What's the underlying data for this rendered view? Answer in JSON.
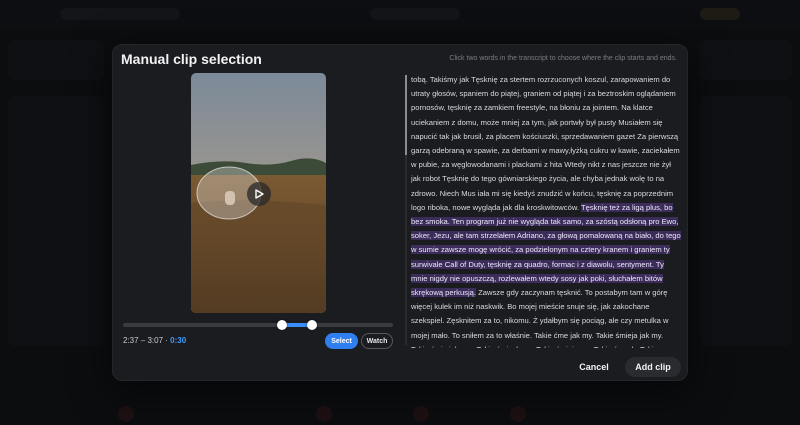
{
  "modal": {
    "title": "Manual clip selection",
    "hint": "Click two words in the transcript to choose where the clip starts and ends."
  },
  "player": {
    "range_label": "2:37 – 3:07",
    "separator": "·",
    "duration": "0:30",
    "select_label": "Select",
    "watch_label": "Watch",
    "play_icon": "play-icon",
    "selection_start_fraction": 0.59,
    "selection_end_fraction": 0.7
  },
  "transcript": {
    "before": "tobą. Takiśmy jak Tęsknię za stertem rozrzuconych koszul, zarapowaniem do utraty głosów, spaniem do piątej, graniem od piątej i za beztroskim oglądaniem pornosów, tęsknię za zamkiem freestyle, na błoniu za jointem. Na klatce uciekaniem z domu, może mniej za tym, jak portwły był pusty Musiałem się napucić tak jak brusil, za placem kościuszki, sprzedawaniem gazet Za pierwszą garzą odebraną w spawie, za derbami w mawy,łyżką cukru w kawie, zaciekałem w pubie, za węglowodanami i plackami z hita Wtedy nikt z nas jeszcze nie żył jak robot Tęsknię do tego gówniarskiego życia, ale chyba jednak wolę to na zdrowo. Niech Mus iała mi się kiedyś znudzić w końcu, tęsknię za poprzednim logo riboka, nowe wygląda jak dla kroskwitowców.",
    "highlighted": "Tęsknię też za ligą plus, bo bez smoka. Ten program już nie wygląda tak samo, za szóstą odsłoną pro Ewo, soker, Jezu, ale tam strzelałem Adriano, za głową pomalowaną na biało, do tego w sumie zawsze mogę wrócić, za podzielonym na cztery kranem i graniem ty surwivale Call of Duty, tęsknię za quadro, formac i z diawolu, sentyment. Ty mnie nigdy nie opuszczą, rozlewałem wtedy sosy jak poki, słuchałem bitów skrękową perkusją.",
    "after": "Zawsze gdy zaczynam tęsknić. To postabym tam w górę więcej kulek im niż naskwik. Bo mojej mieście snuje się, jak zakochane szekspiel. Zęsknitem za to, nikomu. Ż ydałbym się pociąg, ale czy metulka w mojej mało. To sniłem za to właśnie. Takie ćme jak my. Takie śmieja jak my. Takie śmia jak ,my. Takie śmiach my. Takie śmieja my. Takie śmech. Takie śmieje jak my"
  },
  "actions": {
    "cancel_label": "Cancel",
    "add_label": "Add clip"
  },
  "colors": {
    "accent": "#2f7ff0",
    "highlight": "#3b2c5a"
  }
}
